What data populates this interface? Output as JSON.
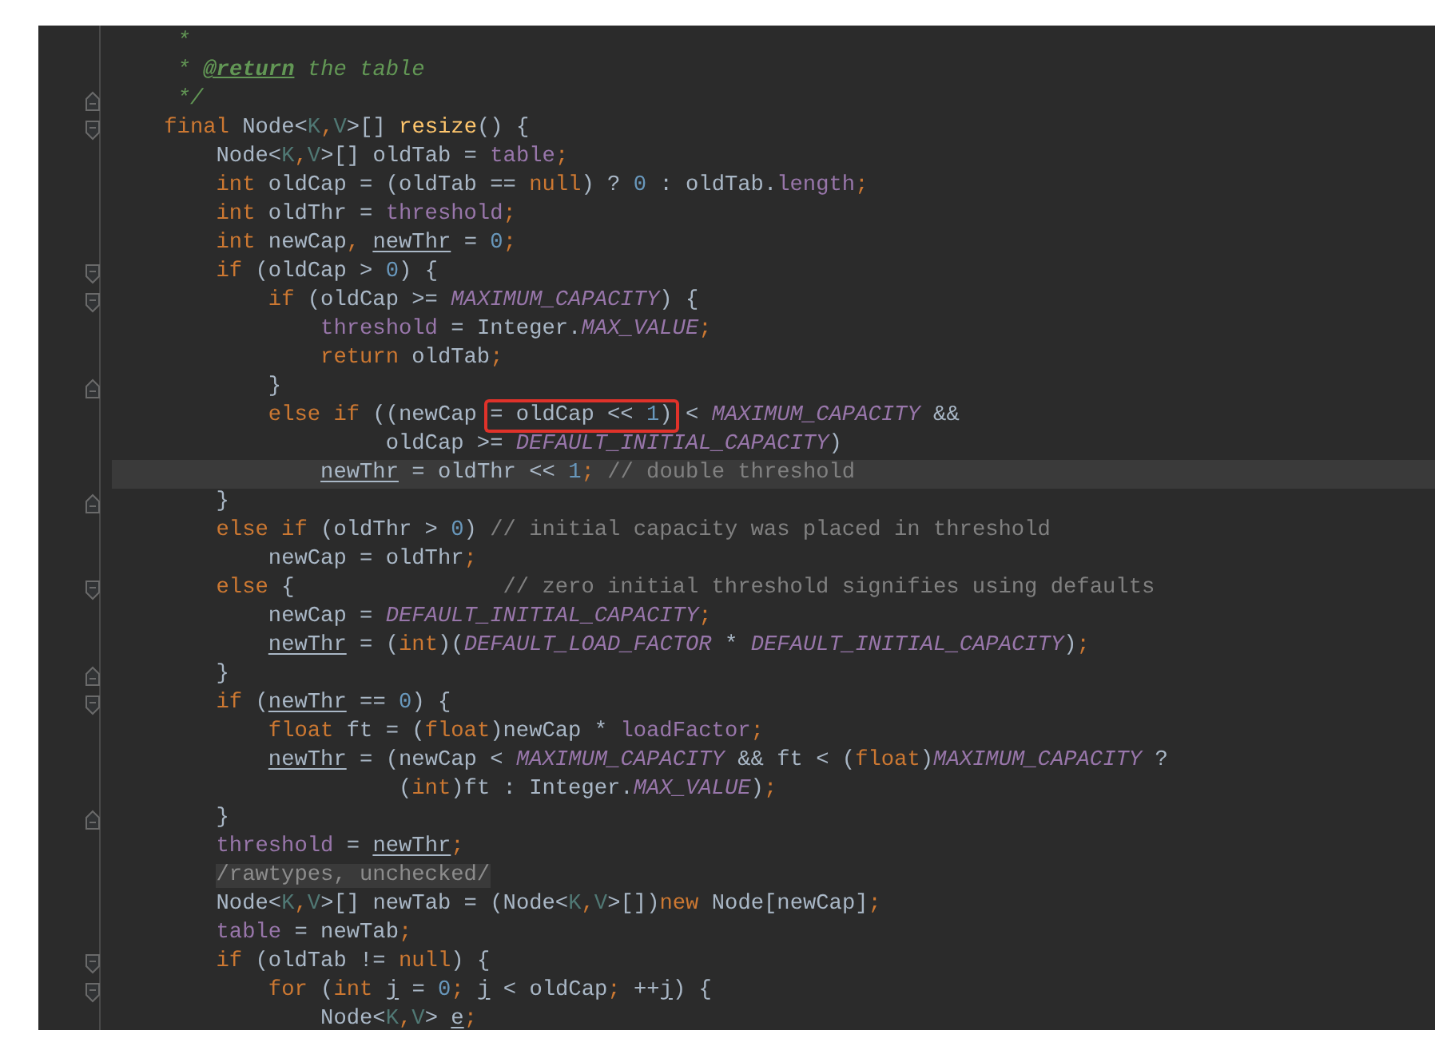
{
  "editor": {
    "lines": [
      {
        "current": false,
        "fold_start": false,
        "fold_end": false,
        "tokens": [
          {
            "kind": "doc",
            "text": "     *"
          }
        ]
      },
      {
        "current": false,
        "fold_start": false,
        "fold_end": false,
        "tokens": [
          {
            "kind": "doc",
            "text": "     * "
          },
          {
            "kind": "doctag",
            "text": "@return"
          },
          {
            "kind": "doc",
            "text": " the table"
          }
        ]
      },
      {
        "current": false,
        "fold_start": false,
        "fold_end": true,
        "tokens": [
          {
            "kind": "doc",
            "text": "     */"
          }
        ]
      },
      {
        "current": false,
        "fold_start": true,
        "fold_end": false,
        "tokens": [
          {
            "kind": "kw",
            "text": "    final "
          },
          {
            "kind": "plain",
            "text": "Node<"
          },
          {
            "kind": "tparam",
            "text": "K"
          },
          {
            "kind": "punct",
            "text": ","
          },
          {
            "kind": "tparam",
            "text": "V"
          },
          {
            "kind": "plain",
            "text": ">[] "
          },
          {
            "kind": "method",
            "text": "resize"
          },
          {
            "kind": "plain",
            "text": "() {"
          }
        ]
      },
      {
        "current": false,
        "fold_start": false,
        "fold_end": false,
        "tokens": [
          {
            "kind": "plain",
            "text": "        Node<"
          },
          {
            "kind": "tparam",
            "text": "K"
          },
          {
            "kind": "punct",
            "text": ","
          },
          {
            "kind": "tparam",
            "text": "V"
          },
          {
            "kind": "plain",
            "text": ">[] oldTab = "
          },
          {
            "kind": "field",
            "text": "table"
          },
          {
            "kind": "punct",
            "text": ";"
          }
        ]
      },
      {
        "current": false,
        "fold_start": false,
        "fold_end": false,
        "tokens": [
          {
            "kind": "kw",
            "text": "        int "
          },
          {
            "kind": "plain",
            "text": "oldCap = (oldTab == "
          },
          {
            "kind": "kw",
            "text": "null"
          },
          {
            "kind": "plain",
            "text": ") ? "
          },
          {
            "kind": "num",
            "text": "0"
          },
          {
            "kind": "plain",
            "text": " : oldTab."
          },
          {
            "kind": "field",
            "text": "length"
          },
          {
            "kind": "punct",
            "text": ";"
          }
        ]
      },
      {
        "current": false,
        "fold_start": false,
        "fold_end": false,
        "tokens": [
          {
            "kind": "kw",
            "text": "        int "
          },
          {
            "kind": "plain",
            "text": "oldThr = "
          },
          {
            "kind": "field",
            "text": "threshold"
          },
          {
            "kind": "punct",
            "text": ";"
          }
        ]
      },
      {
        "current": false,
        "fold_start": false,
        "fold_end": false,
        "tokens": [
          {
            "kind": "kw",
            "text": "        int "
          },
          {
            "kind": "plain",
            "text": "newCap"
          },
          {
            "kind": "punct",
            "text": ", "
          },
          {
            "kind": "var",
            "text": "newThr"
          },
          {
            "kind": "plain",
            "text": " = "
          },
          {
            "kind": "num",
            "text": "0"
          },
          {
            "kind": "punct",
            "text": ";"
          }
        ]
      },
      {
        "current": false,
        "fold_start": true,
        "fold_end": false,
        "tokens": [
          {
            "kind": "kw",
            "text": "        if "
          },
          {
            "kind": "plain",
            "text": "(oldCap > "
          },
          {
            "kind": "num",
            "text": "0"
          },
          {
            "kind": "plain",
            "text": ") {"
          }
        ]
      },
      {
        "current": false,
        "fold_start": true,
        "fold_end": false,
        "tokens": [
          {
            "kind": "kw",
            "text": "            if "
          },
          {
            "kind": "plain",
            "text": "(oldCap >= "
          },
          {
            "kind": "const",
            "text": "MAXIMUM_CAPACITY"
          },
          {
            "kind": "plain",
            "text": ") {"
          }
        ]
      },
      {
        "current": false,
        "fold_start": false,
        "fold_end": false,
        "tokens": [
          {
            "kind": "field",
            "text": "                threshold"
          },
          {
            "kind": "plain",
            "text": " = Integer."
          },
          {
            "kind": "const",
            "text": "MAX_VALUE"
          },
          {
            "kind": "punct",
            "text": ";"
          }
        ]
      },
      {
        "current": false,
        "fold_start": false,
        "fold_end": false,
        "tokens": [
          {
            "kind": "kw",
            "text": "                return "
          },
          {
            "kind": "plain",
            "text": "oldTab"
          },
          {
            "kind": "punct",
            "text": ";"
          }
        ]
      },
      {
        "current": false,
        "fold_start": false,
        "fold_end": true,
        "tokens": [
          {
            "kind": "plain",
            "text": "            }"
          }
        ]
      },
      {
        "current": false,
        "fold_start": false,
        "fold_end": false,
        "tokens": [
          {
            "kind": "kw",
            "text": "            else if "
          },
          {
            "kind": "plain",
            "text": "((newCap "
          },
          {
            "kind": "plain",
            "text": "= oldCap << ",
            "boxed": true
          },
          {
            "kind": "num",
            "text": "1",
            "boxed": true
          },
          {
            "kind": "plain",
            "text": ")",
            "boxed": true
          },
          {
            "kind": "plain",
            "text": " < "
          },
          {
            "kind": "const",
            "text": "MAXIMUM_CAPACITY"
          },
          {
            "kind": "plain",
            "text": " &&"
          }
        ]
      },
      {
        "current": false,
        "fold_start": false,
        "fold_end": false,
        "tokens": [
          {
            "kind": "plain",
            "text": "                     oldCap >= "
          },
          {
            "kind": "const",
            "text": "DEFAULT_INITIAL_CAPACITY"
          },
          {
            "kind": "plain",
            "text": ")"
          }
        ]
      },
      {
        "current": true,
        "fold_start": false,
        "fold_end": false,
        "tokens": [
          {
            "kind": "var",
            "text": "                newThr"
          },
          {
            "kind": "plain",
            "text": " = oldThr << "
          },
          {
            "kind": "num",
            "text": "1"
          },
          {
            "kind": "punct",
            "text": ";"
          },
          {
            "kind": "comment",
            "text": " // double threshold"
          }
        ]
      },
      {
        "current": false,
        "fold_start": false,
        "fold_end": true,
        "tokens": [
          {
            "kind": "plain",
            "text": "        }"
          }
        ]
      },
      {
        "current": false,
        "fold_start": false,
        "fold_end": false,
        "tokens": [
          {
            "kind": "kw",
            "text": "        else if "
          },
          {
            "kind": "plain",
            "text": "(oldThr > "
          },
          {
            "kind": "num",
            "text": "0"
          },
          {
            "kind": "plain",
            "text": ") "
          },
          {
            "kind": "comment",
            "text": "// initial capacity was placed in threshold"
          }
        ]
      },
      {
        "current": false,
        "fold_start": false,
        "fold_end": false,
        "tokens": [
          {
            "kind": "plain",
            "text": "            newCap = oldThr"
          },
          {
            "kind": "punct",
            "text": ";"
          }
        ]
      },
      {
        "current": false,
        "fold_start": true,
        "fold_end": false,
        "tokens": [
          {
            "kind": "kw",
            "text": "        else "
          },
          {
            "kind": "plain",
            "text": "{                "
          },
          {
            "kind": "comment",
            "text": "// zero initial threshold signifies using defaults"
          }
        ]
      },
      {
        "current": false,
        "fold_start": false,
        "fold_end": false,
        "tokens": [
          {
            "kind": "plain",
            "text": "            newCap = "
          },
          {
            "kind": "const",
            "text": "DEFAULT_INITIAL_CAPACITY"
          },
          {
            "kind": "punct",
            "text": ";"
          }
        ]
      },
      {
        "current": false,
        "fold_start": false,
        "fold_end": false,
        "tokens": [
          {
            "kind": "var",
            "text": "            newThr"
          },
          {
            "kind": "plain",
            "text": " = ("
          },
          {
            "kind": "kw",
            "text": "int"
          },
          {
            "kind": "plain",
            "text": ")("
          },
          {
            "kind": "const",
            "text": "DEFAULT_LOAD_FACTOR"
          },
          {
            "kind": "plain",
            "text": " * "
          },
          {
            "kind": "const",
            "text": "DEFAULT_INITIAL_CAPACITY"
          },
          {
            "kind": "plain",
            "text": ")"
          },
          {
            "kind": "punct",
            "text": ";"
          }
        ]
      },
      {
        "current": false,
        "fold_start": false,
        "fold_end": true,
        "tokens": [
          {
            "kind": "plain",
            "text": "        }"
          }
        ]
      },
      {
        "current": false,
        "fold_start": true,
        "fold_end": false,
        "tokens": [
          {
            "kind": "kw",
            "text": "        if "
          },
          {
            "kind": "plain",
            "text": "("
          },
          {
            "kind": "var",
            "text": "newThr"
          },
          {
            "kind": "plain",
            "text": " == "
          },
          {
            "kind": "num",
            "text": "0"
          },
          {
            "kind": "plain",
            "text": ") {"
          }
        ]
      },
      {
        "current": false,
        "fold_start": false,
        "fold_end": false,
        "tokens": [
          {
            "kind": "kw",
            "text": "            float "
          },
          {
            "kind": "plain",
            "text": "ft = ("
          },
          {
            "kind": "kw",
            "text": "float"
          },
          {
            "kind": "plain",
            "text": ")newCap * "
          },
          {
            "kind": "field",
            "text": "loadFactor"
          },
          {
            "kind": "punct",
            "text": ";"
          }
        ]
      },
      {
        "current": false,
        "fold_start": false,
        "fold_end": false,
        "tokens": [
          {
            "kind": "var",
            "text": "            newThr"
          },
          {
            "kind": "plain",
            "text": " = (newCap < "
          },
          {
            "kind": "const",
            "text": "MAXIMUM_CAPACITY"
          },
          {
            "kind": "plain",
            "text": " && ft < ("
          },
          {
            "kind": "kw",
            "text": "float"
          },
          {
            "kind": "plain",
            "text": ")"
          },
          {
            "kind": "const",
            "text": "MAXIMUM_CAPACITY"
          },
          {
            "kind": "plain",
            "text": " ?"
          }
        ]
      },
      {
        "current": false,
        "fold_start": false,
        "fold_end": false,
        "tokens": [
          {
            "kind": "plain",
            "text": "                      ("
          },
          {
            "kind": "kw",
            "text": "int"
          },
          {
            "kind": "plain",
            "text": ")ft : Integer."
          },
          {
            "kind": "const",
            "text": "MAX_VALUE"
          },
          {
            "kind": "plain",
            "text": ")"
          },
          {
            "kind": "punct",
            "text": ";"
          }
        ]
      },
      {
        "current": false,
        "fold_start": false,
        "fold_end": true,
        "tokens": [
          {
            "kind": "plain",
            "text": "        }"
          }
        ]
      },
      {
        "current": false,
        "fold_start": false,
        "fold_end": false,
        "tokens": [
          {
            "kind": "field",
            "text": "        threshold"
          },
          {
            "kind": "plain",
            "text": " = "
          },
          {
            "kind": "var",
            "text": "newThr"
          },
          {
            "kind": "punct",
            "text": ";"
          }
        ]
      },
      {
        "current": false,
        "fold_start": false,
        "fold_end": false,
        "tokens": [
          {
            "kind": "folded",
            "text": "        /rawtypes, unchecked/"
          }
        ]
      },
      {
        "current": false,
        "fold_start": false,
        "fold_end": false,
        "tokens": [
          {
            "kind": "plain",
            "text": "        Node<"
          },
          {
            "kind": "tparam",
            "text": "K"
          },
          {
            "kind": "punct",
            "text": ","
          },
          {
            "kind": "tparam",
            "text": "V"
          },
          {
            "kind": "plain",
            "text": ">[] newTab = (Node<"
          },
          {
            "kind": "tparam",
            "text": "K"
          },
          {
            "kind": "punct",
            "text": ","
          },
          {
            "kind": "tparam",
            "text": "V"
          },
          {
            "kind": "plain",
            "text": ">[])"
          },
          {
            "kind": "kw",
            "text": "new "
          },
          {
            "kind": "plain",
            "text": "Node[newCap]"
          },
          {
            "kind": "punct",
            "text": ";"
          }
        ]
      },
      {
        "current": false,
        "fold_start": false,
        "fold_end": false,
        "tokens": [
          {
            "kind": "field",
            "text": "        table"
          },
          {
            "kind": "plain",
            "text": " = newTab"
          },
          {
            "kind": "punct",
            "text": ";"
          }
        ]
      },
      {
        "current": false,
        "fold_start": true,
        "fold_end": false,
        "tokens": [
          {
            "kind": "kw",
            "text": "        if "
          },
          {
            "kind": "plain",
            "text": "(oldTab != "
          },
          {
            "kind": "kw",
            "text": "null"
          },
          {
            "kind": "plain",
            "text": ") {"
          }
        ]
      },
      {
        "current": false,
        "fold_start": true,
        "fold_end": false,
        "tokens": [
          {
            "kind": "kw",
            "text": "            for "
          },
          {
            "kind": "plain",
            "text": "("
          },
          {
            "kind": "kw",
            "text": "int "
          },
          {
            "kind": "var",
            "text": "j"
          },
          {
            "kind": "plain",
            "text": " = "
          },
          {
            "kind": "num",
            "text": "0"
          },
          {
            "kind": "punct",
            "text": "; "
          },
          {
            "kind": "var",
            "text": "j"
          },
          {
            "kind": "plain",
            "text": " < oldCap"
          },
          {
            "kind": "punct",
            "text": "; "
          },
          {
            "kind": "plain",
            "text": "++"
          },
          {
            "kind": "var",
            "text": "j"
          },
          {
            "kind": "plain",
            "text": ") {"
          }
        ]
      },
      {
        "current": false,
        "fold_start": false,
        "fold_end": false,
        "tokens": [
          {
            "kind": "plain",
            "text": "                Node<"
          },
          {
            "kind": "tparam",
            "text": "K"
          },
          {
            "kind": "punct",
            "text": ","
          },
          {
            "kind": "tparam",
            "text": "V"
          },
          {
            "kind": "plain",
            "text": "> "
          },
          {
            "kind": "var",
            "text": "e"
          },
          {
            "kind": "punct",
            "text": ";"
          }
        ]
      }
    ]
  }
}
